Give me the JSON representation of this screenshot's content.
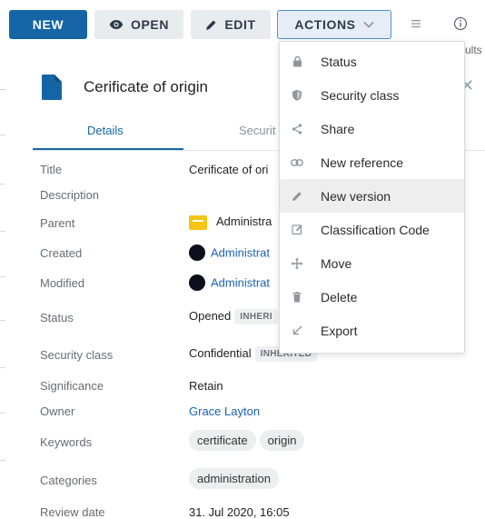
{
  "toolbar": {
    "new_label": "NEW",
    "open_label": "OPEN",
    "edit_label": "EDIT",
    "actions_label": "ACTIONS",
    "peek_text": "ults"
  },
  "document": {
    "title": "Cerificate of origin",
    "icon": "document-icon"
  },
  "tabs": [
    {
      "label": "Details"
    },
    {
      "label": "Securit"
    }
  ],
  "fields": {
    "title": {
      "label": "Title",
      "value": "Cerificate of ori"
    },
    "description": {
      "label": "Description",
      "value": ""
    },
    "parent": {
      "label": "Parent",
      "value": "Administra"
    },
    "created": {
      "label": "Created",
      "value": "Administrat"
    },
    "modified": {
      "label": "Modified",
      "value": "Administrat"
    },
    "status": {
      "label": "Status",
      "value": "Opened",
      "badge": "INHERI"
    },
    "security": {
      "label": "Security class",
      "value": "Confidential",
      "badge": "INHERITED"
    },
    "significance": {
      "label": "Significance",
      "value": "Retain"
    },
    "owner": {
      "label": "Owner",
      "value": "Grace Layton"
    },
    "keywords": {
      "label": "Keywords",
      "values": [
        "certificate",
        "origin"
      ]
    },
    "categories": {
      "label": "Categories",
      "values": [
        "administration"
      ]
    },
    "review": {
      "label": "Review date",
      "value": "31. Jul 2020, 16:05"
    }
  },
  "actions_menu": {
    "items": [
      {
        "label": "Status",
        "icon": "lock-icon"
      },
      {
        "label": "Security class",
        "icon": "shield-icon"
      },
      {
        "label": "Share",
        "icon": "share-icon"
      },
      {
        "label": "New reference",
        "icon": "link-icon"
      },
      {
        "label": "New version",
        "icon": "pencil-icon",
        "highlighted": true
      },
      {
        "label": "Classification Code",
        "icon": "edit-box-icon"
      },
      {
        "label": "Move",
        "icon": "move-icon"
      },
      {
        "label": "Delete",
        "icon": "trash-icon"
      },
      {
        "label": "Export",
        "icon": "export-arrow-icon"
      }
    ]
  },
  "colors": {
    "primary": "#1565a6",
    "link": "#1b63b3",
    "folder": "#f6c514",
    "actions_border": "#4a8fd6"
  }
}
